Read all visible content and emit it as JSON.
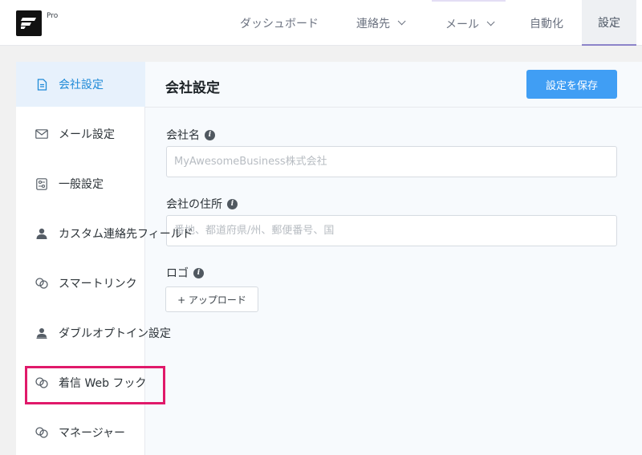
{
  "app": {
    "badge": "Pro"
  },
  "nav": {
    "dashboard": "ダッシュボード",
    "contacts": "連絡先",
    "email": "メール",
    "automation": "自動化",
    "settings": "設定"
  },
  "sidebar": {
    "items": [
      {
        "label": "会社設定",
        "icon": "document-icon",
        "active": true
      },
      {
        "label": "メール設定",
        "icon": "envelope-icon"
      },
      {
        "label": "一般設定",
        "icon": "sliders-icon"
      },
      {
        "label": "カスタム連絡先フィールド",
        "icon": "user-icon"
      },
      {
        "label": "スマートリンク",
        "icon": "link-icon"
      },
      {
        "label": "ダブルオプトイン設定",
        "icon": "user-check-icon"
      },
      {
        "label": "着信 Web フック",
        "icon": "webhook-icon"
      },
      {
        "label": "マネージャー",
        "icon": "link-icon"
      }
    ]
  },
  "main": {
    "title": "会社設定",
    "save_label": "設定を保存",
    "fields": {
      "company_name": {
        "label": "会社名",
        "placeholder": "MyAwesomeBusiness株式会社",
        "value": ""
      },
      "company_address": {
        "label": "会社の住所",
        "placeholder": "番地、都道府県/州、郵便番号、国",
        "value": ""
      },
      "logo": {
        "label": "ロゴ",
        "upload_label": "+ アップロード"
      }
    }
  },
  "colors": {
    "accent": "#409ef4",
    "active_bg": "#e7f1fc",
    "highlight": "#e0196a"
  }
}
